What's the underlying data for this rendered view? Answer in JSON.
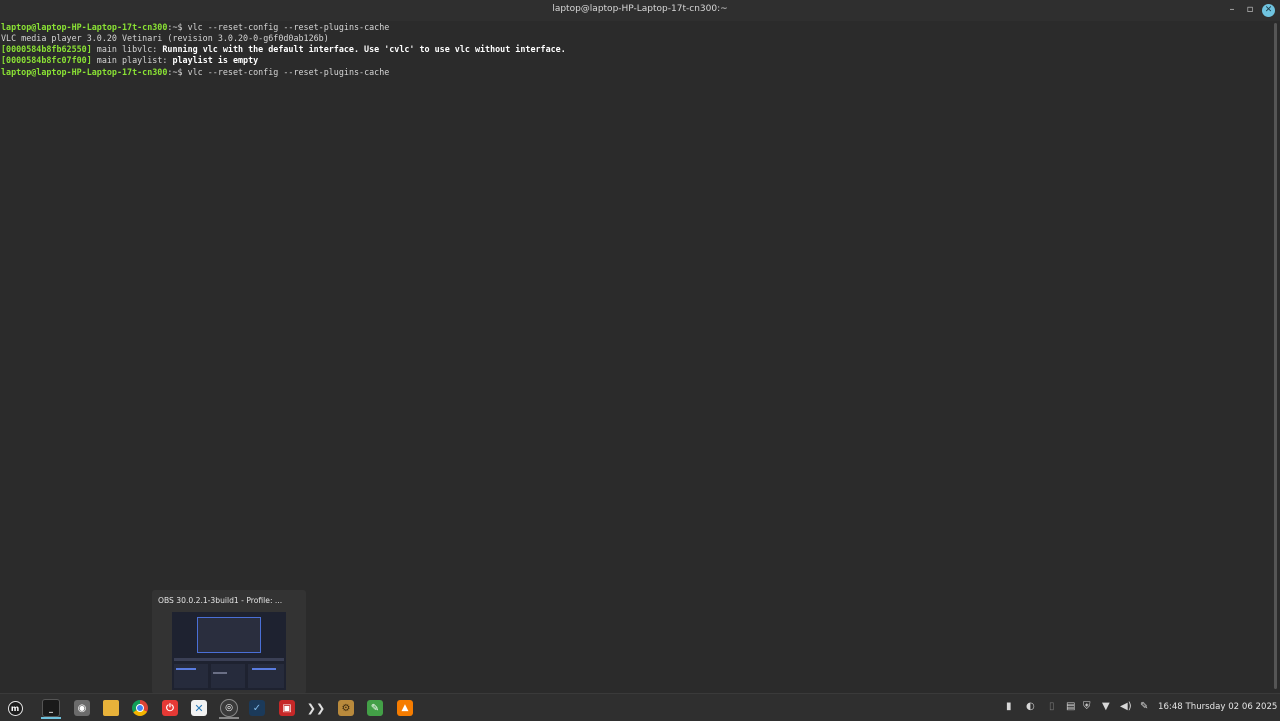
{
  "window": {
    "title": "laptop@laptop-HP-Laptop-17t-cn300:~"
  },
  "terminal": {
    "lines": [
      {
        "prompt": "laptop@laptop-HP-Laptop-17t-cn300",
        "path": ":~$",
        "cmd": " vlc --reset-config --reset-plugins-cache"
      },
      {
        "text": "VLC media player 3.0.20 Vetinari (revision 3.0.20-0-g6f0d0ab126b)"
      },
      {
        "hex": "[0000584b8fb62550]",
        "module": " main libvlc: ",
        "msg": "Running vlc with the default interface. Use 'cvlc' to use vlc without interface."
      },
      {
        "hex": "[0000584b8fc07f00]",
        "module": " main playlist: ",
        "msg": "playlist is empty"
      },
      {
        "prompt": "laptop@laptop-HP-Laptop-17t-cn300",
        "path": ":~$",
        "cmd": " vlc --reset-config --reset-plugins-cache"
      }
    ]
  },
  "preview": {
    "title": "OBS 30.0.2.1-3build1 - Profile: ..."
  },
  "taskbar": {
    "apps": [
      {
        "name": "menu-icon",
        "glyph": "ⓜ"
      },
      {
        "name": "terminal-icon",
        "glyph": "_"
      },
      {
        "name": "disk-icon",
        "glyph": "◍"
      },
      {
        "name": "files-icon",
        "glyph": "▬"
      },
      {
        "name": "chrome-icon",
        "glyph": "●"
      },
      {
        "name": "app-red-icon",
        "glyph": "⏻"
      },
      {
        "name": "vs-icon",
        "glyph": "✕"
      },
      {
        "name": "obs-icon",
        "glyph": "◎"
      },
      {
        "name": "steam-icon",
        "glyph": "✓"
      },
      {
        "name": "app-store-icon",
        "glyph": "▣"
      },
      {
        "name": "clapper-icon",
        "glyph": "❯"
      },
      {
        "name": "settings-icon",
        "glyph": "⚙"
      },
      {
        "name": "notes-icon",
        "glyph": "✎"
      },
      {
        "name": "vlc-icon",
        "glyph": "▲"
      }
    ],
    "clock": "16:48 Thursday 02 06 2025"
  },
  "colors": {
    "background": "#2b2b2b",
    "prompt": "#8ae234",
    "accent": "#6fc3df"
  }
}
